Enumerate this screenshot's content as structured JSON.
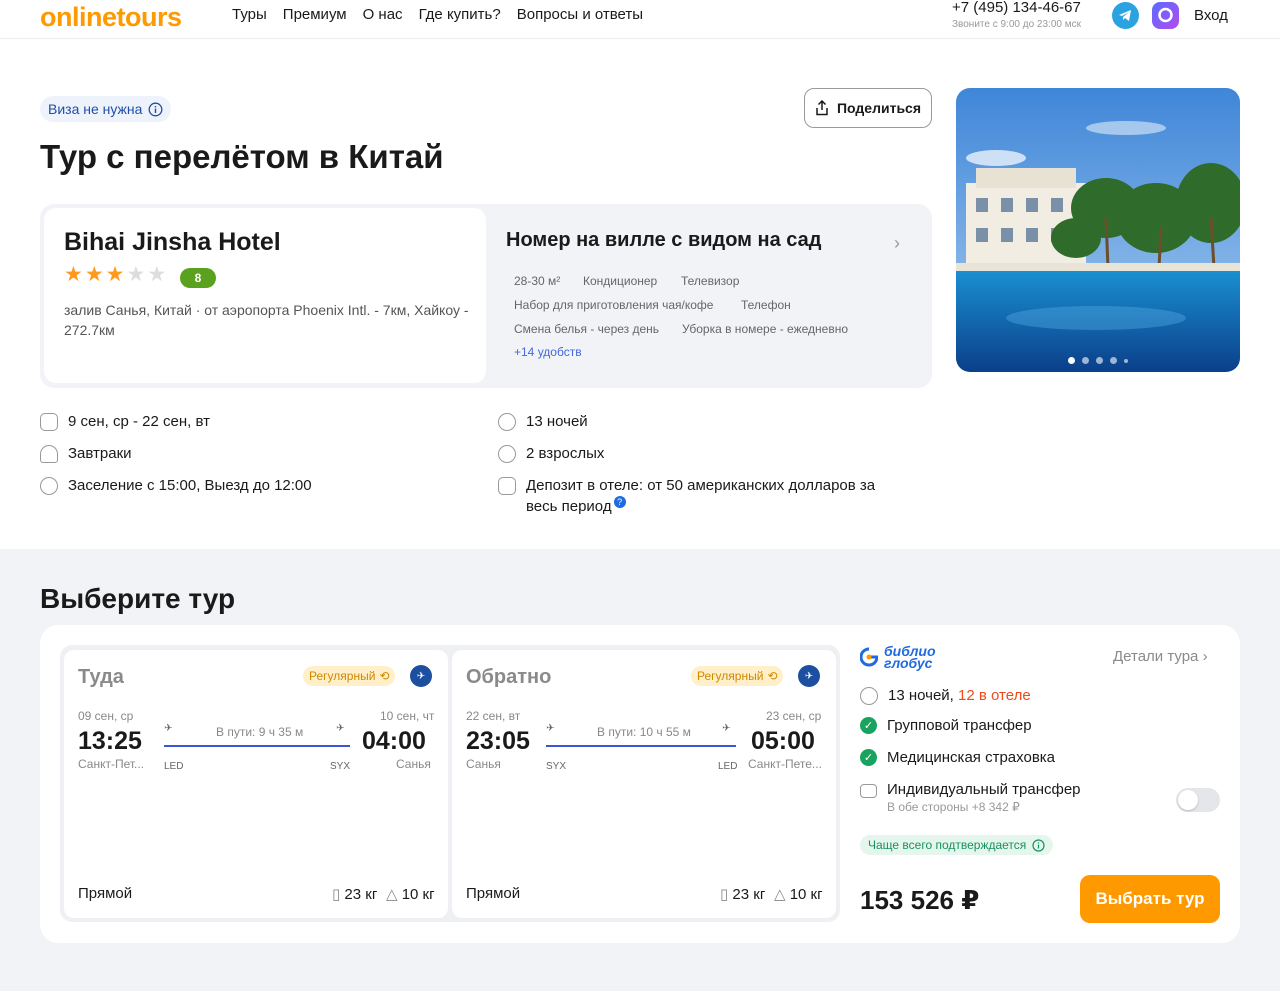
{
  "header": {
    "logo": "onlinetours",
    "nav": [
      "Туры",
      "Премиум",
      "О нас",
      "Где купить?",
      "Вопросы и ответы"
    ],
    "phone": "+7 (495) 134-46-67",
    "phone_note": "Звоните с 9:00 до 23:00 мск",
    "login": "Вход"
  },
  "hero": {
    "visa": "Виза не нужна",
    "share": "Поделиться",
    "title": "Тур с перелётом в Китай"
  },
  "hotel": {
    "name": "Bihai Jinsha Hotel",
    "stars": 3,
    "rating": "8",
    "address": "залив Санья, Китай · от аэропорта Phoenix Intl. - 7км, Хайкоу - 272.7км"
  },
  "room": {
    "title": "Номер на вилле с видом на сад",
    "amenities": [
      "28-30 м²",
      "Кондиционер",
      "Телевизор",
      "Набор для приготовления чая/кофе",
      "Телефон",
      "Смена белья - через день",
      "Уборка в номере - ежедневно"
    ],
    "more": "+14 удобств"
  },
  "details": {
    "dates": "9 сен, ср - 22 сен, вт",
    "nights": "13 ночей",
    "meal": "Завтраки",
    "guests": "2 взрослых",
    "checkin": "Заселение с 15:00, Выезд до 12:00",
    "deposit": "Депозит в отеле: от 50 американских долларов за весь период"
  },
  "section_title": "Выберите тур",
  "flights": [
    {
      "dir": "Туда",
      "type": "Регулярный",
      "dep_date": "09 сен, ср",
      "arr_date": "10 сен, чт",
      "dep_time": "13:25",
      "arr_time": "04:00",
      "duration": "В пути: 9 ч 35 м",
      "from": "Санкт-Пет...",
      "to": "Санья",
      "from_code": "LED",
      "to_code": "SYX",
      "stops": "Прямой",
      "bag": "23 кг",
      "hand": "10 кг"
    },
    {
      "dir": "Обратно",
      "type": "Регулярный",
      "dep_date": "22 сен, вт",
      "arr_date": "23 сен, ср",
      "dep_time": "23:05",
      "arr_time": "05:00",
      "duration": "В пути: 10 ч 55 м",
      "from": "Санья",
      "to": "Санкт-Пете...",
      "from_code": "SYX",
      "to_code": "LED",
      "stops": "Прямой",
      "bag": "23 кг",
      "hand": "10 кг"
    }
  ],
  "tour": {
    "operator_l1": "библио",
    "operator_l2": "глобус",
    "details": "Детали тура",
    "nights": "13 ночей,",
    "nights_hotel": "12 в отеле",
    "transfer": "Групповой трансфер",
    "insurance": "Медицинская страховка",
    "ind_transfer": "Индивидуальный трансфер",
    "ind_transfer_price": "В обе стороны +8 342 ₽",
    "confirm": "Чаще всего подтверждается",
    "price": "153 526 ₽",
    "select": "Выбрать тур"
  }
}
